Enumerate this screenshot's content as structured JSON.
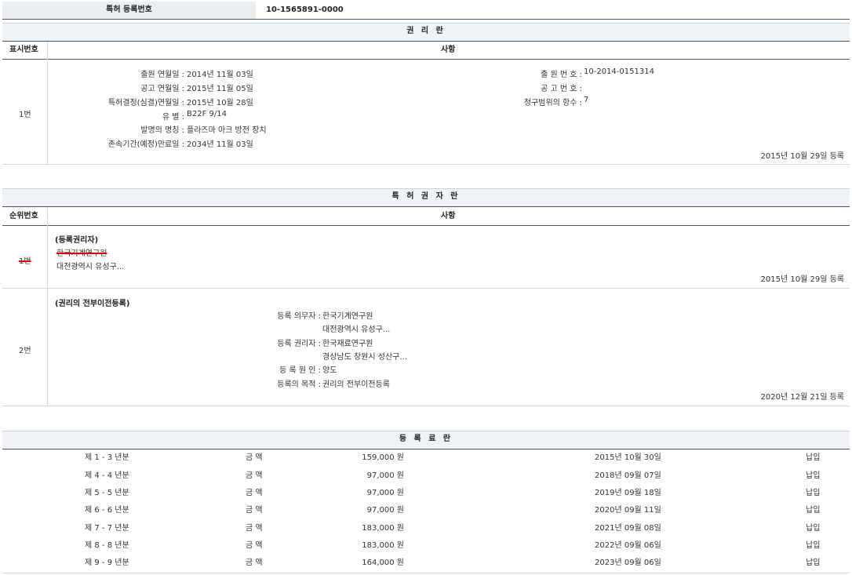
{
  "registration": {
    "label": "특허 등록번호",
    "number": "10-1565891-0000"
  },
  "rights": {
    "title": "권 리 란",
    "col_no": "표시번호",
    "col_item": "사항",
    "row_no": "1번",
    "fields_left": [
      {
        "label": "출원 연월일 :",
        "value": "2014년 11월 03일"
      },
      {
        "label": "공고 연월일 :",
        "value": "2015년 11월 05일"
      },
      {
        "label": "특허결정(심결)연월일 :",
        "value": "2015년 10월 28일"
      },
      {
        "label": "유 별 :",
        "value": "B22F 9/14"
      },
      {
        "label": "발명의 명칭 :",
        "value": "플라즈마 아크 방전 장치"
      },
      {
        "label": "존속기간(예정)만료일 :",
        "value": "2034년 11월 03일"
      }
    ],
    "fields_right": [
      {
        "label": "출 원 번 호 :",
        "value": "10-2014-0151314"
      },
      {
        "label": "공 고 번 호 :",
        "value": ""
      },
      {
        "label": "청구범위의 항수 :",
        "value": "7"
      }
    ],
    "reg_date": "2015년 10월 29일 등록"
  },
  "holders": {
    "title": "특 허 권 자 란",
    "col_no": "순위번호",
    "col_item": "사항",
    "row1": {
      "no": "1번",
      "type": "(등록권리자)",
      "name": "한국기계연구원",
      "address": "대전광역시 유성구...",
      "reg_date": "2015년 10월 29일 등록"
    },
    "row2": {
      "no": "2번",
      "type": "(권리의 전부이전등록)",
      "fields": [
        {
          "label": "등록 의무자 :",
          "value": "한국기계연구원"
        },
        {
          "label": "",
          "value": "대전광역시 유성구..."
        },
        {
          "label": "등록 권리자 :",
          "value": "한국재료연구원"
        },
        {
          "label": "",
          "value": "경상남도 창원시 성산구..."
        },
        {
          "label": "등 록 원 인 :",
          "value": "양도"
        },
        {
          "label": "등록의 목적 :",
          "value": "권리의 전부이전등록"
        }
      ],
      "reg_date": "2020년 12월 21일 등록"
    }
  },
  "fees": {
    "title": "등 록 료 란",
    "rows": [
      {
        "year": "제 1 - 3 년분",
        "amt_label": "금 액",
        "amount": "159,000 원",
        "date": "2015년 10월 30일",
        "status": "납입"
      },
      {
        "year": "제 4 - 4 년분",
        "amt_label": "금 액",
        "amount": "97,000 원",
        "date": "2018년 09월 07일",
        "status": "납입"
      },
      {
        "year": "제 5 - 5 년분",
        "amt_label": "금 액",
        "amount": "97,000 원",
        "date": "2019년 09월 18일",
        "status": "납입"
      },
      {
        "year": "제 6 - 6 년분",
        "amt_label": "금 액",
        "amount": "97,000 원",
        "date": "2020년 09월 11일",
        "status": "납입"
      },
      {
        "year": "제 7 - 7 년분",
        "amt_label": "금 액",
        "amount": "183,000 원",
        "date": "2021년 09월 08일",
        "status": "납입"
      },
      {
        "year": "제 8 - 8 년분",
        "amt_label": "금 액",
        "amount": "183,000 원",
        "date": "2022년 09월 06일",
        "status": "납입"
      },
      {
        "year": "제 9 - 9 년분",
        "amt_label": "금 액",
        "amount": "164,000 원",
        "date": "2023년 09월 06일",
        "status": "납입"
      }
    ]
  }
}
